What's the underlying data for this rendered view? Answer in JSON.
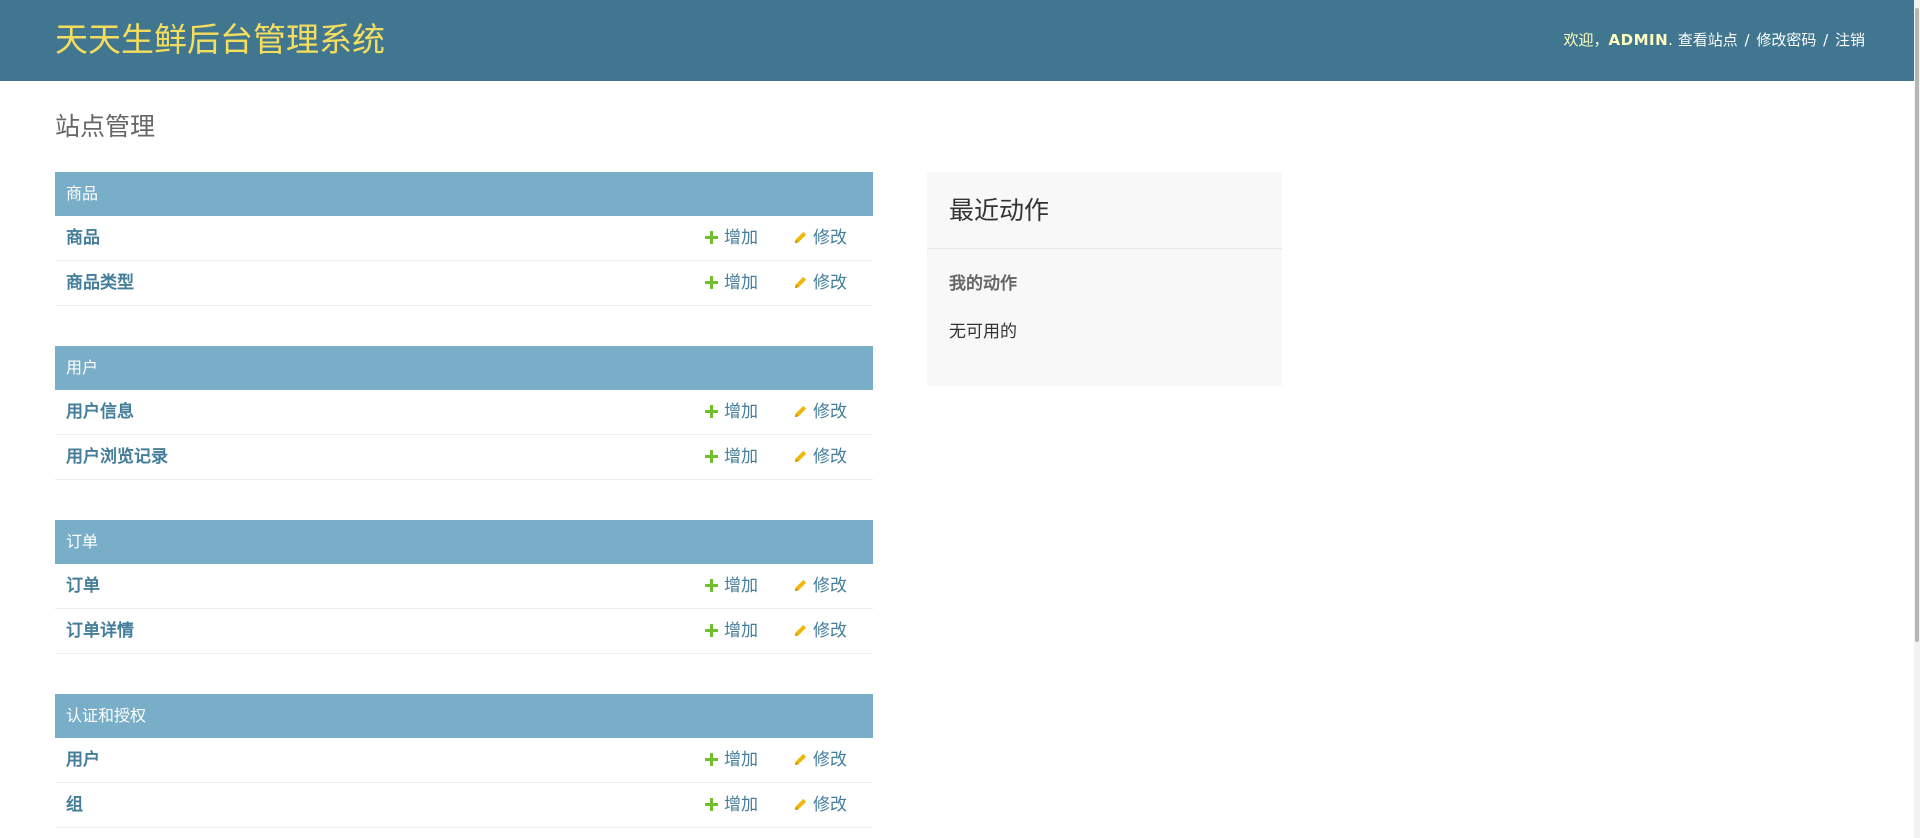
{
  "header": {
    "site_title": "天天生鲜后台管理系统",
    "welcome": "欢迎，",
    "username": "ADMIN",
    "dot": ".",
    "view_site": "查看站点",
    "sep": "/",
    "change_password": "修改密码",
    "logout": "注销",
    "bg_color": "#417690",
    "title_color": "#f5dd5d"
  },
  "page_title": "站点管理",
  "modules": [
    {
      "caption": "商品",
      "models": [
        {
          "name": "商品",
          "add": "增加",
          "change": "修改"
        },
        {
          "name": "商品类型",
          "add": "增加",
          "change": "修改"
        }
      ]
    },
    {
      "caption": "用户",
      "models": [
        {
          "name": "用户信息",
          "add": "增加",
          "change": "修改"
        },
        {
          "name": "用户浏览记录",
          "add": "增加",
          "change": "修改"
        }
      ]
    },
    {
      "caption": "订单",
      "models": [
        {
          "name": "订单",
          "add": "增加",
          "change": "修改"
        },
        {
          "name": "订单详情",
          "add": "增加",
          "change": "修改"
        }
      ]
    },
    {
      "caption": "认证和授权",
      "models": [
        {
          "name": "用户",
          "add": "增加",
          "change": "修改"
        },
        {
          "name": "组",
          "add": "增加",
          "change": "修改"
        }
      ]
    }
  ],
  "recent_actions": {
    "title": "最近动作",
    "subtitle": "我的动作",
    "empty_text": "无可用的"
  },
  "icons": {
    "add": "plus-icon",
    "change": "pencil-icon"
  },
  "colors": {
    "module_caption_bg": "#79aec8",
    "link": "#447e9b",
    "add_icon": "#70bf2b",
    "change_icon": "#efb80b"
  }
}
